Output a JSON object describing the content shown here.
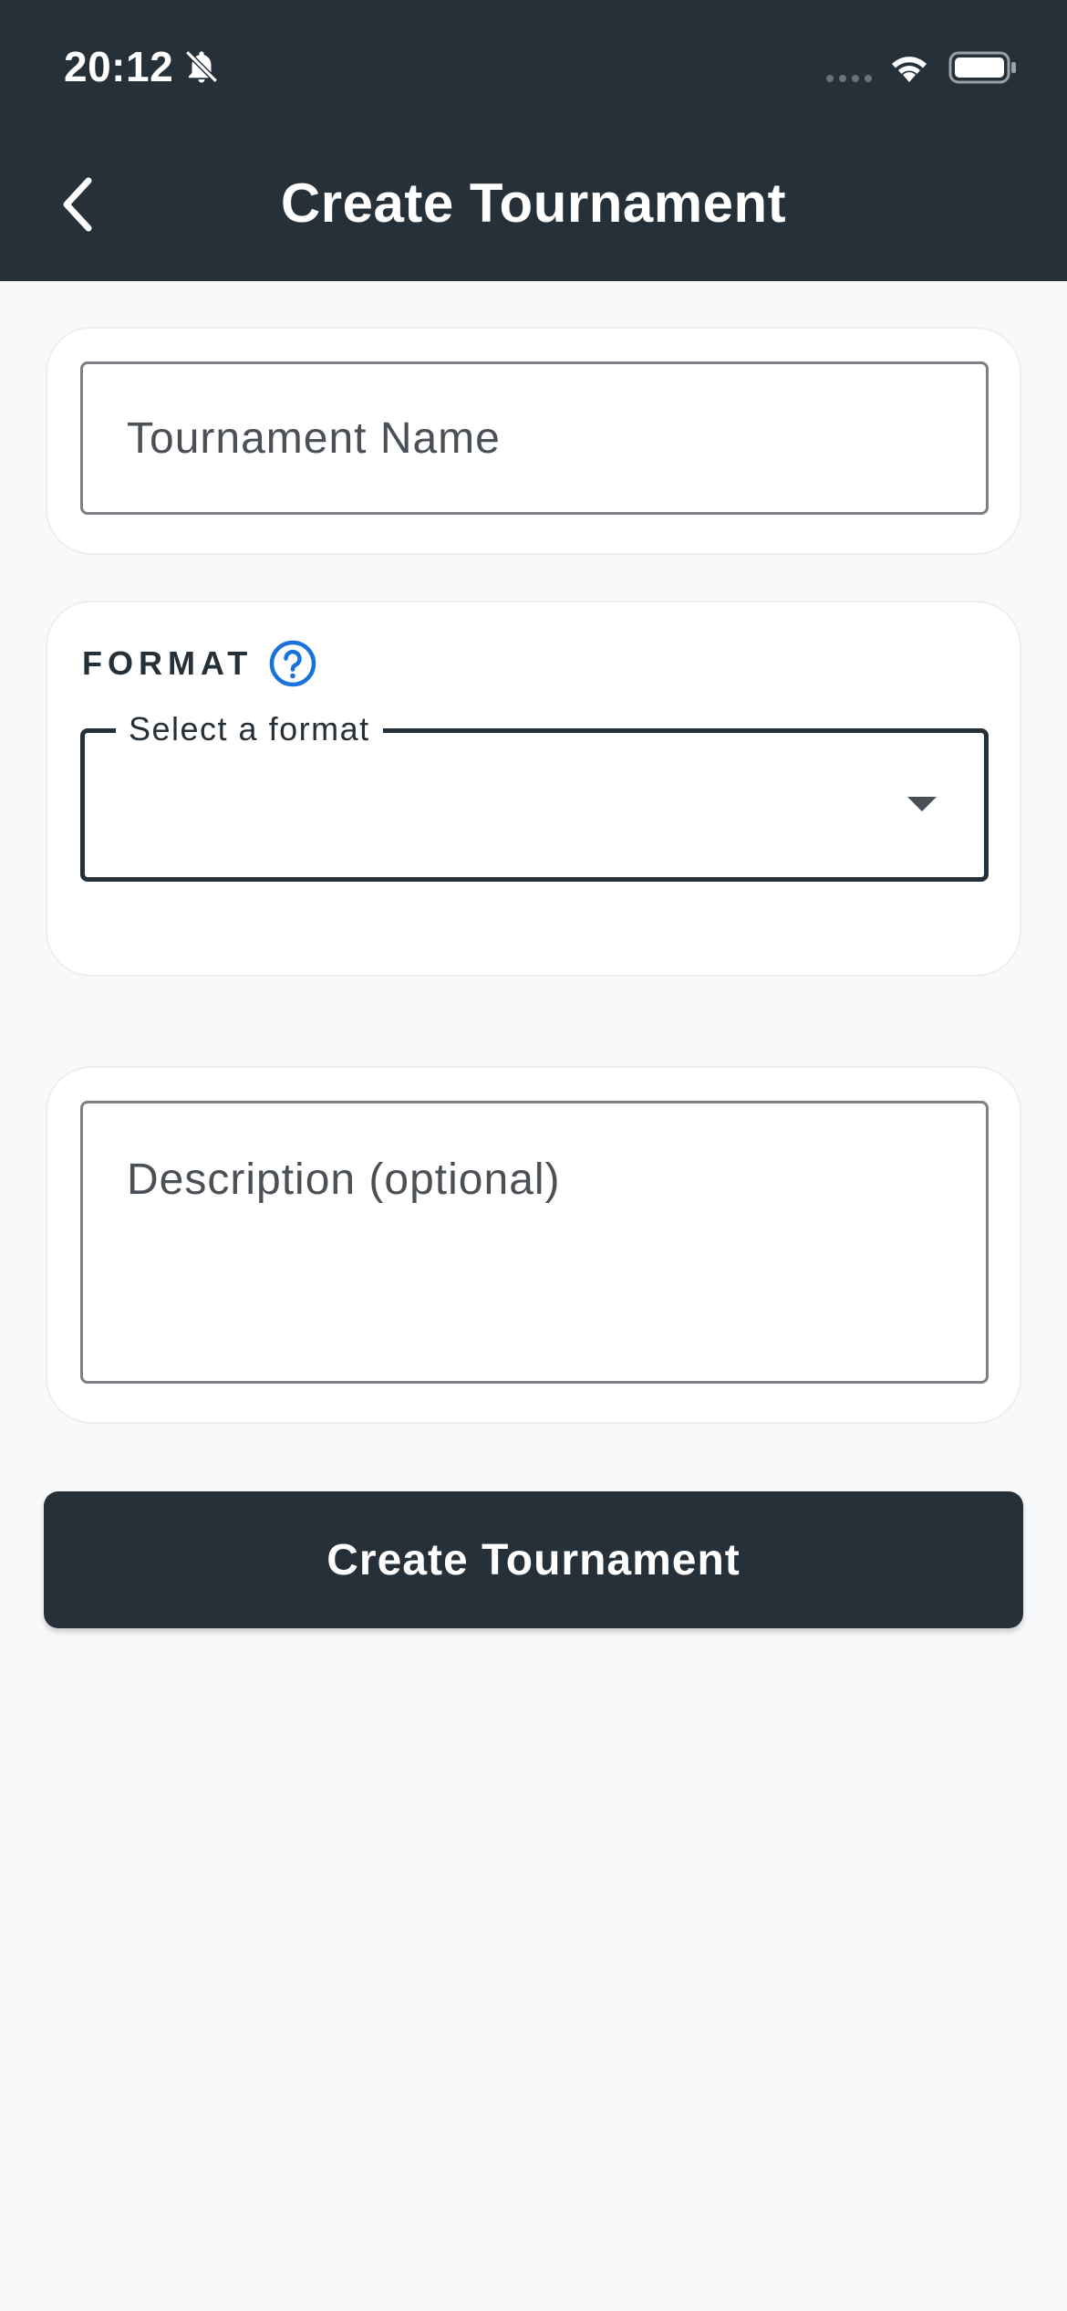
{
  "status_bar": {
    "time": "20:12",
    "icons": [
      "bell-off-icon",
      "signal-icon",
      "wifi-icon",
      "battery-icon"
    ]
  },
  "header": {
    "title": "Create Tournament",
    "back_icon": "chevron-left-icon"
  },
  "form": {
    "name_field": {
      "placeholder": "Tournament Name",
      "value": ""
    },
    "format": {
      "section_label": "FORMAT",
      "help_icon": "question-circle-icon",
      "select_label": "Select a format",
      "selected_value": ""
    },
    "description_field": {
      "placeholder": "Description (optional)",
      "value": ""
    },
    "submit_label": "Create Tournament"
  },
  "colors": {
    "header_bg": "#263038",
    "page_bg": "#f8f9fb",
    "accent": "#1a73d9",
    "button_bg": "#263038"
  }
}
